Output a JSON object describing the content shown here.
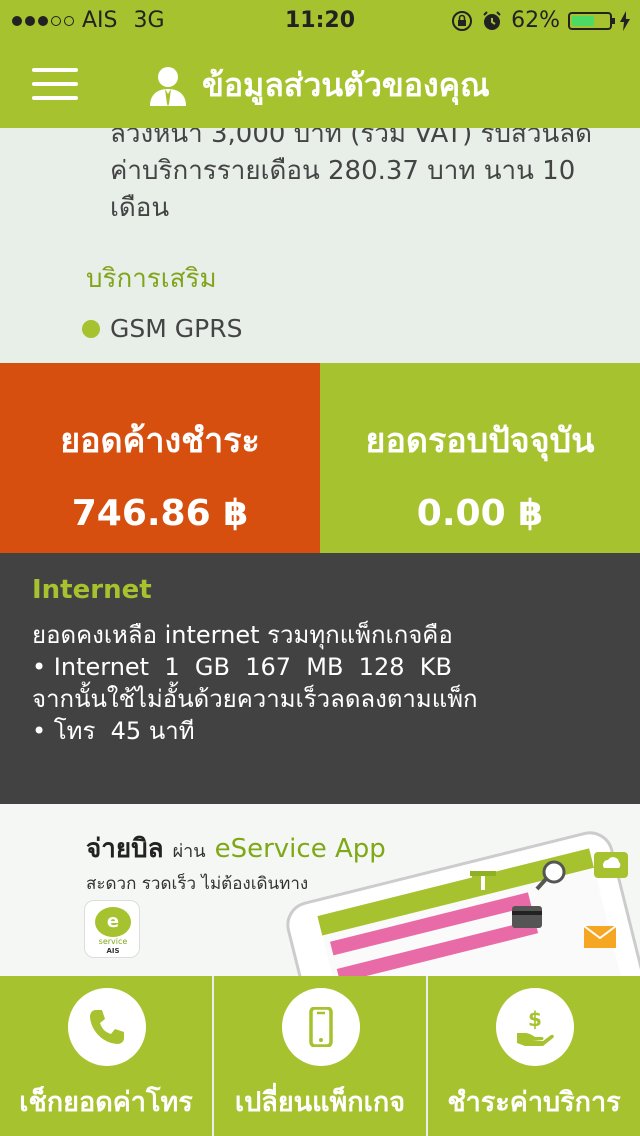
{
  "status_bar": {
    "carrier": "AIS",
    "network": "3G",
    "time": "11:20",
    "battery_percent_text": "62%",
    "battery_level": 0.62,
    "signal_bars_filled": 3,
    "signal_bars_total": 5
  },
  "header": {
    "title": "ข้อมูลส่วนตัวของคุณ",
    "icon": "user-icon"
  },
  "package_info": {
    "lines": [
      "ล่วงหน้า 3,000 บาท (รวม VAT) รับส่วนลด",
      "ค่าบริการรายเดือน 280.37 บาท นาน 10",
      "เดือน"
    ],
    "addon_title": "บริการเสริม",
    "addons": [
      "GSM GPRS"
    ]
  },
  "balances": {
    "outstanding": {
      "label": "ยอดค้างชำระ",
      "value": "746.86 ฿"
    },
    "current": {
      "label": "ยอดรอบปัจจุบัน",
      "value": "0.00 ฿"
    }
  },
  "internet": {
    "title": "Internet",
    "lines": [
      "ยอดคงเหลือ internet รวมทุกแพ็กเกจคือ",
      "• Internet  1  GB  167  MB  128  KB",
      "จากนั้นใช้ไม่อั้นด้วยความเร็วลดลงตามแพ็ก",
      "• โทร  45 นาที"
    ]
  },
  "banner": {
    "headline": "จ่ายบิล",
    "via": "ผ่าน",
    "app_name": "eService App",
    "subtitle": "สะดวก รวดเร็ว ไม่ต้องเดินทาง",
    "logo_text": "service",
    "logo_brand": "AIS"
  },
  "bottom_nav": [
    {
      "label": "เช็กยอดค่าโทร",
      "icon": "phone-icon"
    },
    {
      "label": "เปลี่ยนแพ็กเกจ",
      "icon": "mobile-device-icon"
    },
    {
      "label": "ชำระค่าบริการ",
      "icon": "payment-hand-icon"
    }
  ],
  "colors": {
    "brand_green": "#a6c22f",
    "alert_orange": "#d74f0f",
    "dark_panel": "#424242",
    "light_bg": "#e8efe9"
  }
}
